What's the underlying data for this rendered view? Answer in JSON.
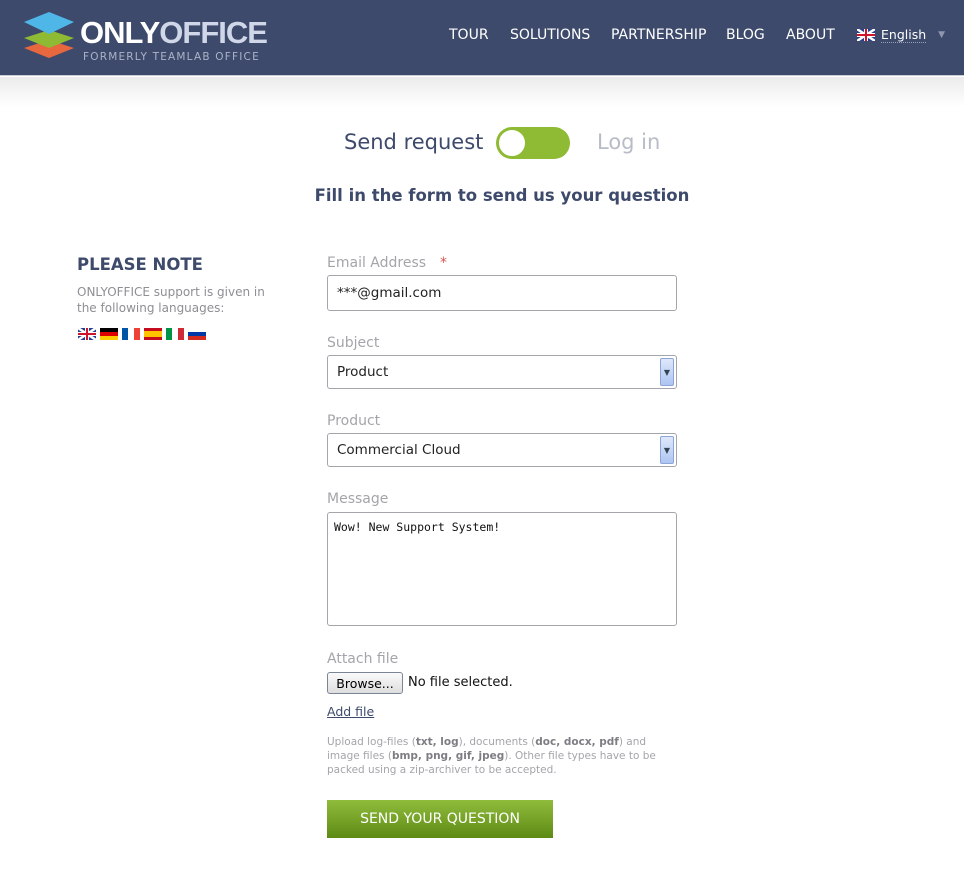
{
  "header": {
    "logo_main": "ONLY",
    "logo_accent": "OFFICE",
    "logo_sub": "FORMERLY TEAMLAB OFFICE",
    "nav": [
      "TOUR",
      "SOLUTIONS",
      "PARTNERSHIP",
      "BLOG",
      "ABOUT"
    ],
    "language": "English"
  },
  "toggle": {
    "left": "Send request",
    "right": "Log in",
    "state": "Send request"
  },
  "subtitle": "Fill in the form to send us your question",
  "note": {
    "title": "PLEASE NOTE",
    "text": "ONLYOFFICE support is given in the following languages:",
    "flags": [
      "english",
      "german",
      "french",
      "spanish",
      "italian",
      "russian"
    ]
  },
  "form": {
    "email_label": "Email Address",
    "required_mark": "*",
    "email_value": "***@gmail.com",
    "subject_label": "Subject",
    "subject_value": "Product",
    "product_label": "Product",
    "product_value": "Commercial Cloud",
    "message_label": "Message",
    "message_value": "Wow! New Support System!",
    "attach_label": "Attach file",
    "browse_label": "Browse...",
    "no_file": "No file selected.",
    "add_file": "Add file",
    "hint": {
      "p1": "Upload log-files (",
      "b1": "txt, log",
      "p2": "), documents (",
      "b2": "doc, docx, pdf",
      "p3": ") and image files (",
      "b3": "bmp, png, gif, jpeg",
      "p4": "). Other file types have to be packed using a zip-archiver to be accepted."
    },
    "submit": "SEND YOUR QUESTION"
  },
  "colors": {
    "header_bg": "#3d4a6b",
    "accent_green": "#8fba34"
  }
}
